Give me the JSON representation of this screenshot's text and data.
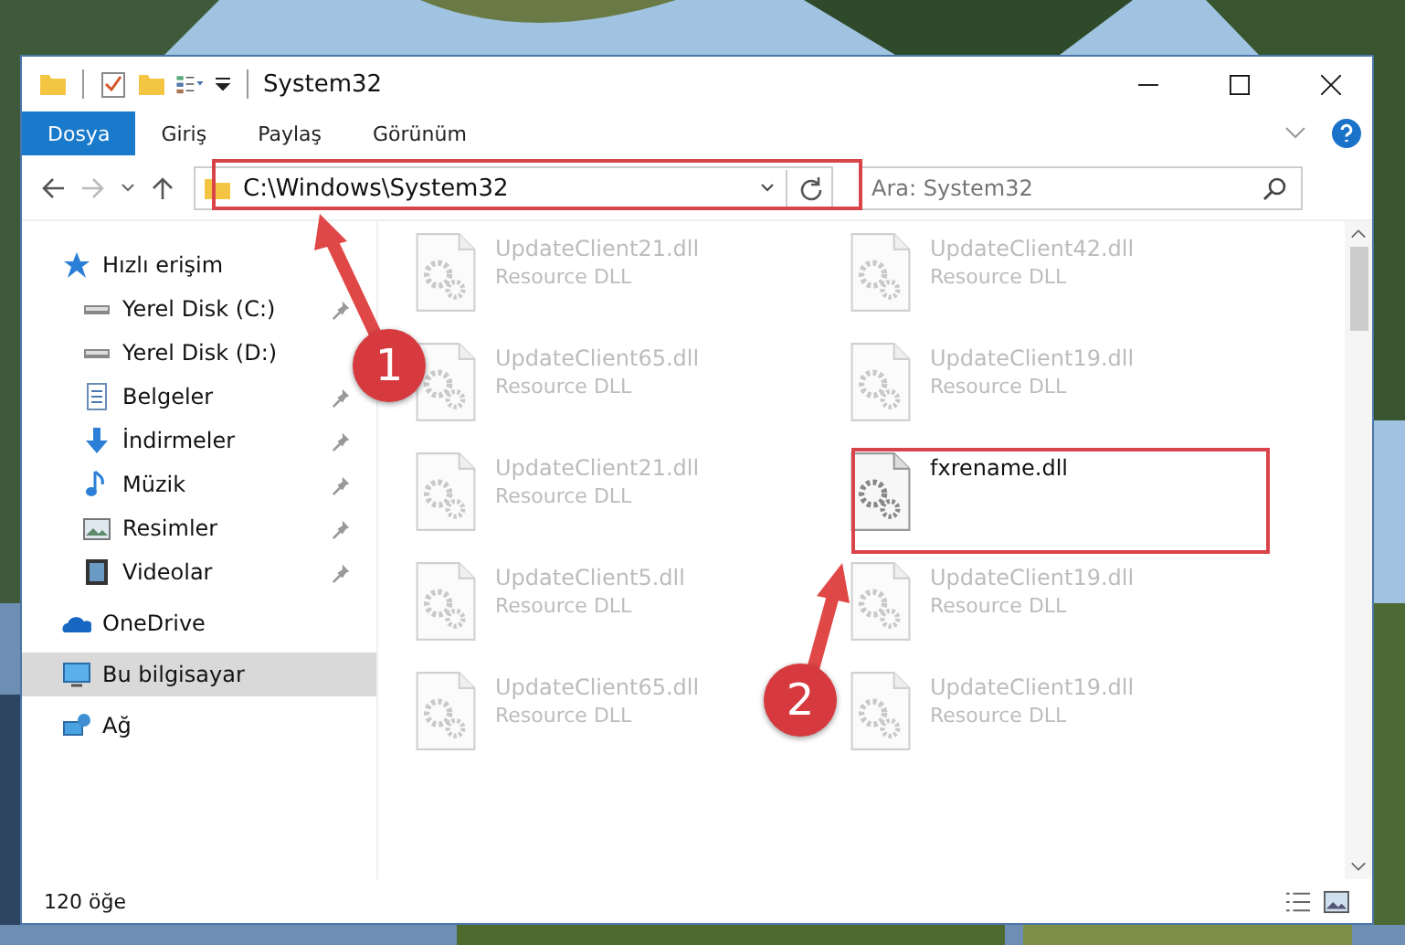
{
  "window": {
    "title": "System32"
  },
  "ribbon_tabs": [
    {
      "label": "Dosya",
      "selected": true
    },
    {
      "label": "Giriş",
      "selected": false
    },
    {
      "label": "Paylaş",
      "selected": false
    },
    {
      "label": "Görünüm",
      "selected": false
    }
  ],
  "address": {
    "path": "C:\\Windows\\System32"
  },
  "search": {
    "placeholder": "Ara: System32"
  },
  "sidebar": {
    "items": [
      {
        "label": "Hızlı erişim",
        "kind": "star",
        "selected": false,
        "children": [
          {
            "label": "Yerel Disk (C:)",
            "kind": "drive",
            "pinned": true
          },
          {
            "label": "Yerel Disk (D:)",
            "kind": "drive",
            "pinned": false
          },
          {
            "label": "Belgeler",
            "kind": "docs",
            "pinned": true
          },
          {
            "label": "İndirmeler",
            "kind": "download",
            "pinned": true
          },
          {
            "label": "Müzik",
            "kind": "music",
            "pinned": true
          },
          {
            "label": "Resimler",
            "kind": "pictures",
            "pinned": true
          },
          {
            "label": "Videolar",
            "kind": "videos",
            "pinned": true
          }
        ]
      },
      {
        "label": "OneDrive",
        "kind": "cloud",
        "selected": false
      },
      {
        "label": "Bu bilgisayar",
        "kind": "pc",
        "selected": true
      },
      {
        "label": "Ağ",
        "kind": "network",
        "selected": false
      }
    ]
  },
  "files": [
    {
      "name": "UpdateClient21.dll",
      "type": "Resource DLL",
      "dimmed": true
    },
    {
      "name": "UpdateClient42.dll",
      "type": "Resource DLL",
      "dimmed": true
    },
    {
      "name": "UpdateClient65.dll",
      "type": "Resource DLL",
      "dimmed": true
    },
    {
      "name": "UpdateClient19.dll",
      "type": "Resource DLL",
      "dimmed": true
    },
    {
      "name": "UpdateClient21.dll",
      "type": "Resource DLL",
      "dimmed": true
    },
    {
      "name": "fxrename.dll",
      "dimmed": false
    },
    {
      "name": "UpdateClient5.dll",
      "type": "Resource DLL",
      "dimmed": true
    },
    {
      "name": "UpdateClient19.dll",
      "type": "Resource DLL",
      "dimmed": true
    },
    {
      "name": "UpdateClient65.dll",
      "type": "Resource DLL",
      "dimmed": true
    },
    {
      "name": "UpdateClient19.dll",
      "type": "Resource DLL",
      "dimmed": true
    }
  ],
  "status_bar": {
    "count": "120 öğe"
  },
  "annotations": [
    {
      "number": "1"
    },
    {
      "number": "2"
    }
  ]
}
